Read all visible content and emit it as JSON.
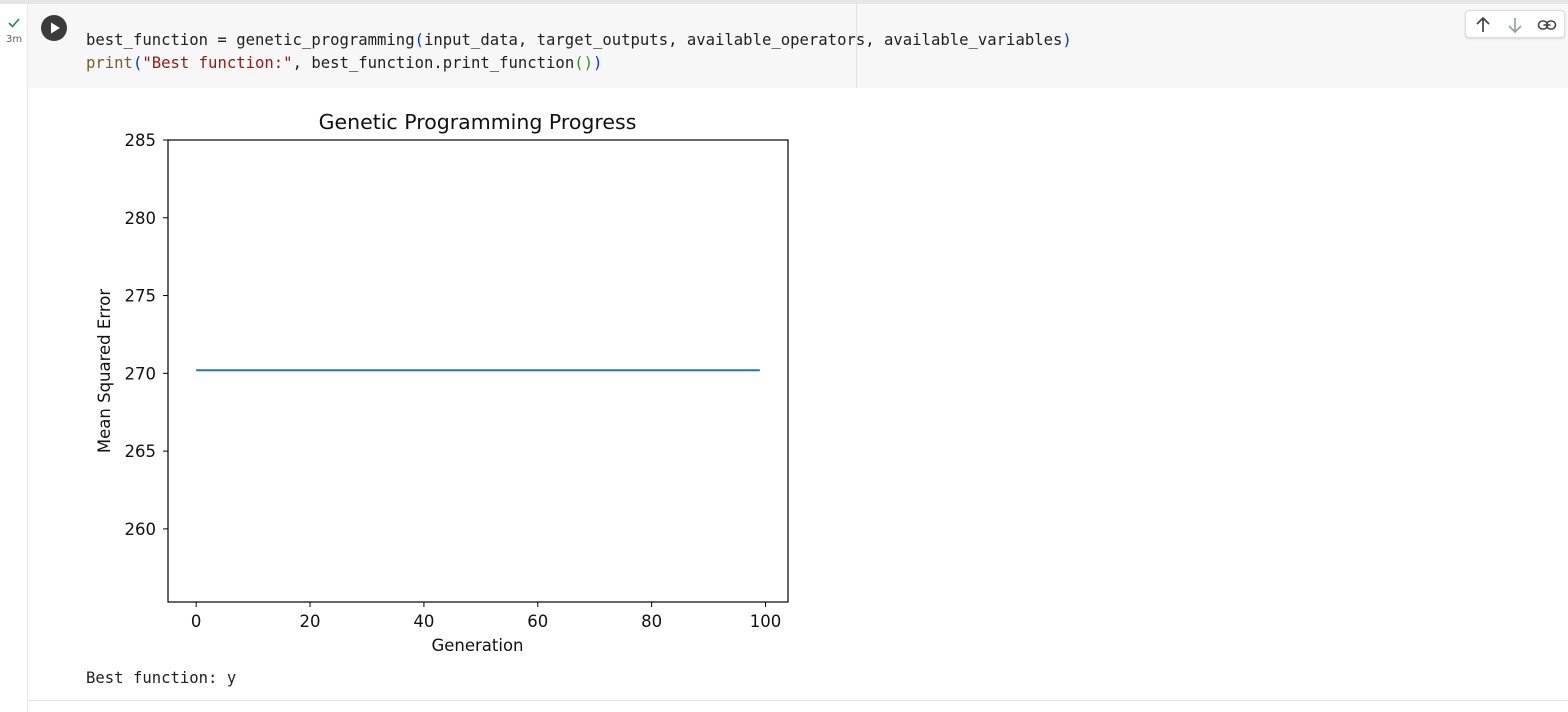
{
  "cell": {
    "exec_time": "3m",
    "code_lines": [
      [
        {
          "text": "best_function = genetic_programming",
          "cls": ""
        },
        {
          "text": "(",
          "cls": "tok-paren1"
        },
        {
          "text": "input_data, target_outputs, available_operators, available_variables",
          "cls": ""
        },
        {
          "text": ")",
          "cls": "tok-paren1"
        }
      ],
      [
        {
          "text": "print",
          "cls": "tok-builtin"
        },
        {
          "text": "(",
          "cls": "tok-paren1"
        },
        {
          "text": "\"Best function:\"",
          "cls": "tok-string"
        },
        {
          "text": ", best_function.print_function",
          "cls": ""
        },
        {
          "text": "()",
          "cls": "tok-paren2"
        },
        {
          "text": ")",
          "cls": "tok-paren1"
        }
      ]
    ],
    "toolbar_icons": [
      "arrow-up-icon",
      "arrow-down-icon",
      "link-icon"
    ],
    "output_text": "Best function: y"
  },
  "chart_data": {
    "type": "line",
    "title": "Genetic Programming Progress",
    "xlabel": "Generation",
    "ylabel": "Mean Squared Error",
    "xlim": [
      -4.95,
      103.95
    ],
    "ylim": [
      255.3,
      285.0
    ],
    "xticks": [
      0,
      20,
      40,
      60,
      80,
      100
    ],
    "yticks": [
      260,
      265,
      270,
      275,
      280,
      285
    ],
    "grid": false,
    "series": [
      {
        "x": [
          0,
          99
        ],
        "values": [
          270.2,
          270.2
        ],
        "color": "#1f77b4"
      }
    ]
  }
}
